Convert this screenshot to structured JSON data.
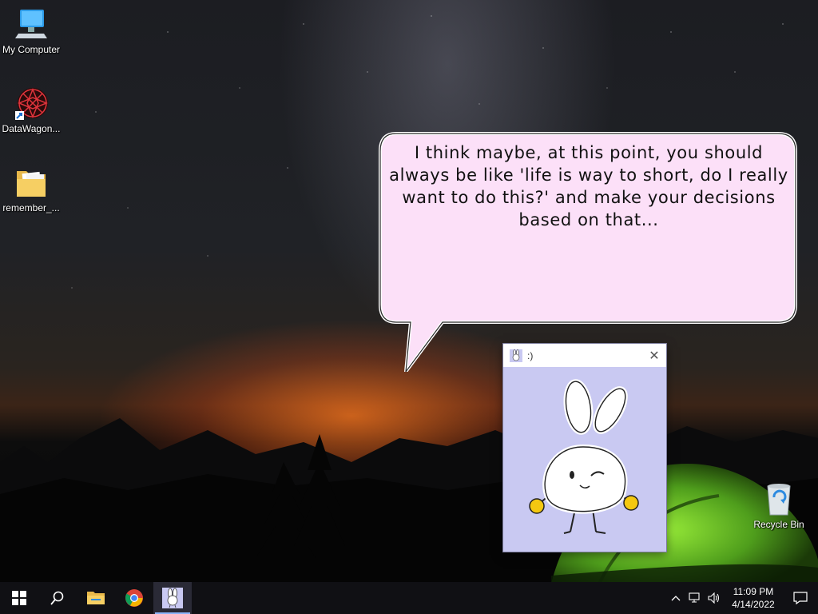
{
  "desktop": {
    "icons": [
      {
        "label": "My Computer",
        "icon": "computer-icon"
      },
      {
        "label": "DataWagon...",
        "icon": "datawagon-shortcut-icon"
      },
      {
        "label": "remember_...",
        "icon": "folder-icon"
      },
      {
        "label": "Recycle Bin",
        "icon": "recycle-bin-icon"
      }
    ]
  },
  "speech_bubble": {
    "text": "I think maybe, at this point, you should always be like 'life is way to short, do I really want to do this?' and make your decisions based on that..."
  },
  "pet_window": {
    "title": ":)",
    "close_symbol": "✕",
    "background_color": "#c9c9f2"
  },
  "taskbar": {
    "items": [
      {
        "name": "start",
        "icon": "windows-logo-icon"
      },
      {
        "name": "search",
        "icon": "search-icon"
      },
      {
        "name": "file-explorer",
        "icon": "folder-icon"
      },
      {
        "name": "chrome",
        "icon": "chrome-icon"
      },
      {
        "name": "desktop-pet",
        "icon": "bunny-icon",
        "active": true
      }
    ],
    "tray": {
      "time": "11:09 PM",
      "date": "4/14/2022",
      "icons": [
        "chevron-up-icon",
        "network-icon",
        "volume-icon",
        "notification-icon"
      ]
    }
  }
}
